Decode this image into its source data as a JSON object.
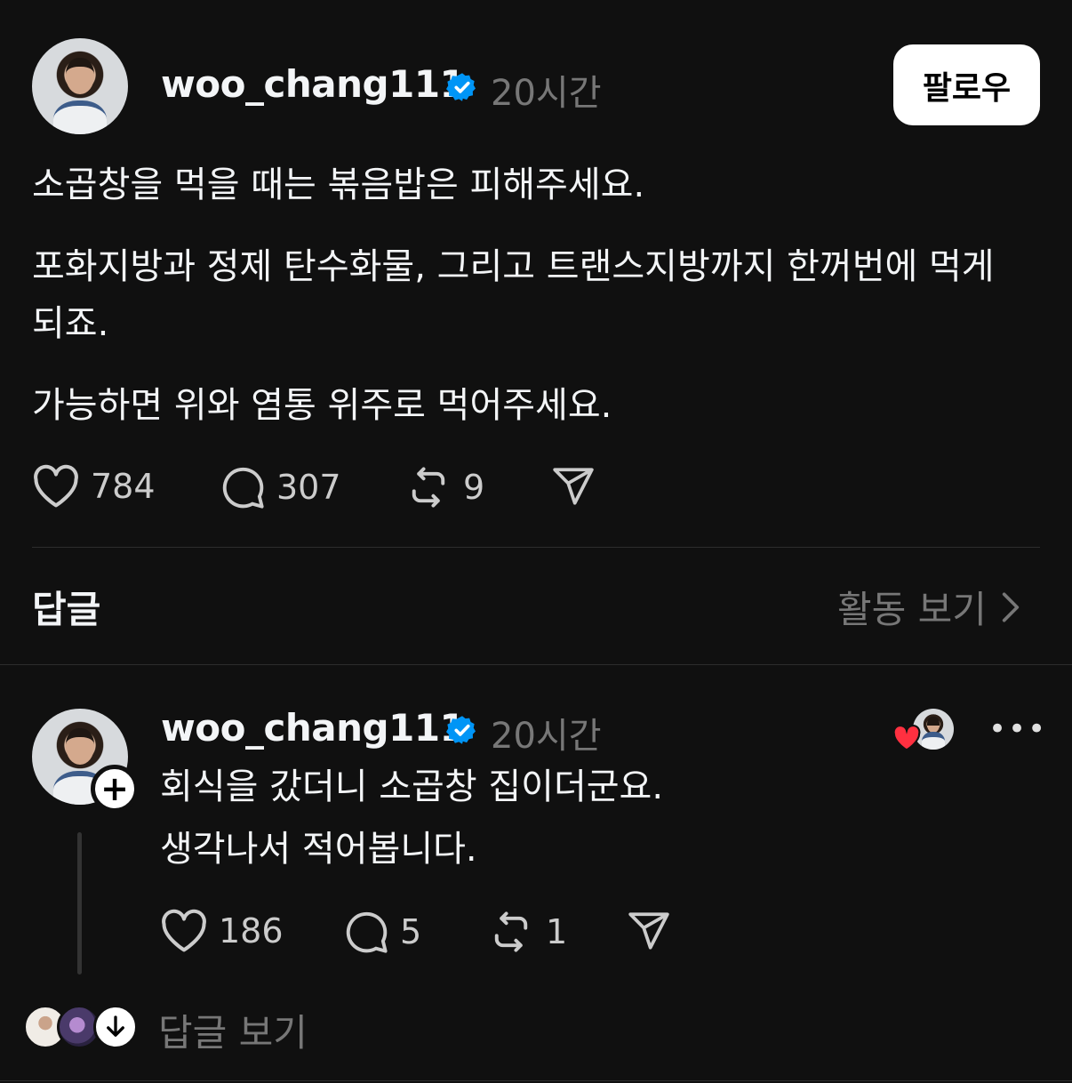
{
  "post": {
    "username": "woo_chang111",
    "time": "20시간",
    "follow_label": "팔로우",
    "paragraphs": [
      "소곱창을 먹을 때는 볶음밥은 피해주세요.",
      "포화지방과 정제 탄수화물, 그리고 트랜스지방까지 한꺼번에 먹게 되죠.",
      "가능하면 위와 염통 위주로 먹어주세요."
    ],
    "stats": {
      "likes": "784",
      "comments": "307",
      "reposts": "9"
    }
  },
  "replies_section": {
    "title": "답글",
    "activity_label": "활동 보기"
  },
  "reply": {
    "username": "woo_chang111",
    "time": "20시간",
    "lines": [
      "회식을 갔더니 소곱창 집이더군요.",
      "생각나서 적어봅니다."
    ],
    "stats": {
      "likes": "186",
      "comments": "5",
      "reposts": "1"
    },
    "view_replies_label": "답글 보기"
  },
  "icons": {
    "heart": "heart-icon",
    "comment": "comment-icon",
    "repost": "repost-icon",
    "share": "share-icon",
    "verified": "verified-badge-icon",
    "chevron": "chevron-right-icon",
    "more": "more-icon",
    "plus": "plus-icon",
    "down": "arrow-down-icon"
  },
  "colors": {
    "background": "#101010",
    "verified": "#0095f6",
    "muted": "#777777",
    "liked_heart": "#ff3040"
  }
}
